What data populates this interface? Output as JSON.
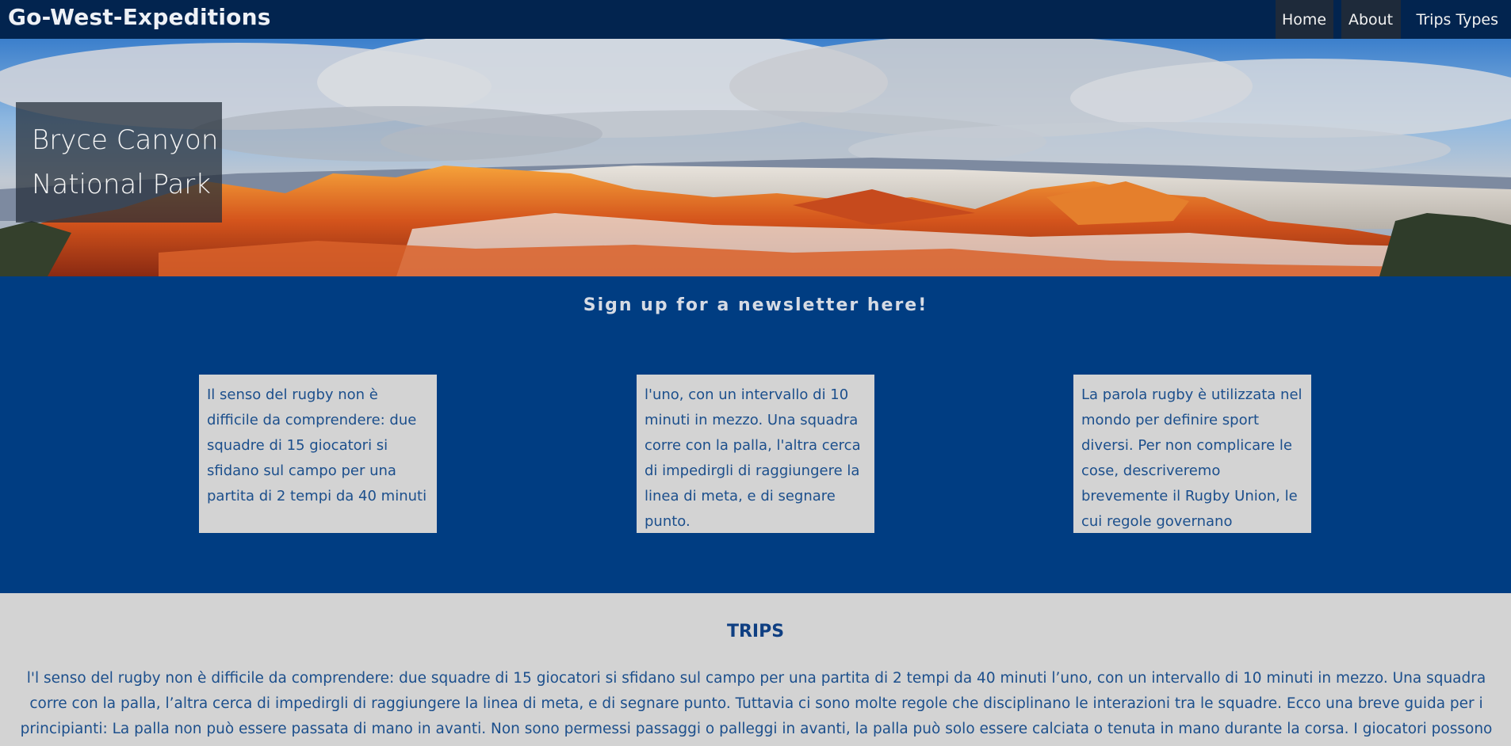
{
  "navbar": {
    "brand": "Go-West-Expeditions",
    "items": [
      {
        "label": "Home"
      },
      {
        "label": "About"
      },
      {
        "label": "Trips Types"
      }
    ]
  },
  "hero": {
    "caption_line1": "Bryce Canyon",
    "caption_line2": "National Park"
  },
  "newsletter": {
    "title": "Sign up for a newsletter here!",
    "cards": [
      {
        "text": "Il senso del rugby non è difficile da comprendere: due squadre di 15 giocatori si sfidano sul campo per una partita di 2 tempi da 40 minuti"
      },
      {
        "text": "l'uno, con un intervallo di 10 minuti in mezzo. Una squadra corre con la palla, l'altra cerca di impedirgli di raggiungere la linea di meta, e di segnare punto."
      },
      {
        "text": "La parola rugby è utilizzata nel mondo per definire sport diversi. Per non complicare le cose, descriveremo brevemente il Rugby Union, le cui regole governano"
      }
    ]
  },
  "trips": {
    "title": "TRIPS",
    "text": "l'l senso del rugby non è difficile da comprendere: due squadre di 15 giocatori si sfidano sul campo per una partita di 2 tempi da 40 minuti l’uno, con un intervallo di 10 minuti in mezzo. Una squadra corre con la palla, l’altra cerca di impedirgli di raggiungere la linea di meta, e di segnare punto. Tuttavia ci sono molte regole che disciplinano le interazioni tra le squadre. Ecco una breve guida per i principianti: La palla non può essere passata di mano in avanti. Non sono permessi passaggi o palleggi in avanti, la palla può solo essere calciata o tenuta in mano durante la corsa. I giocatori possono però passarsela in linea o all’indietro."
  }
}
